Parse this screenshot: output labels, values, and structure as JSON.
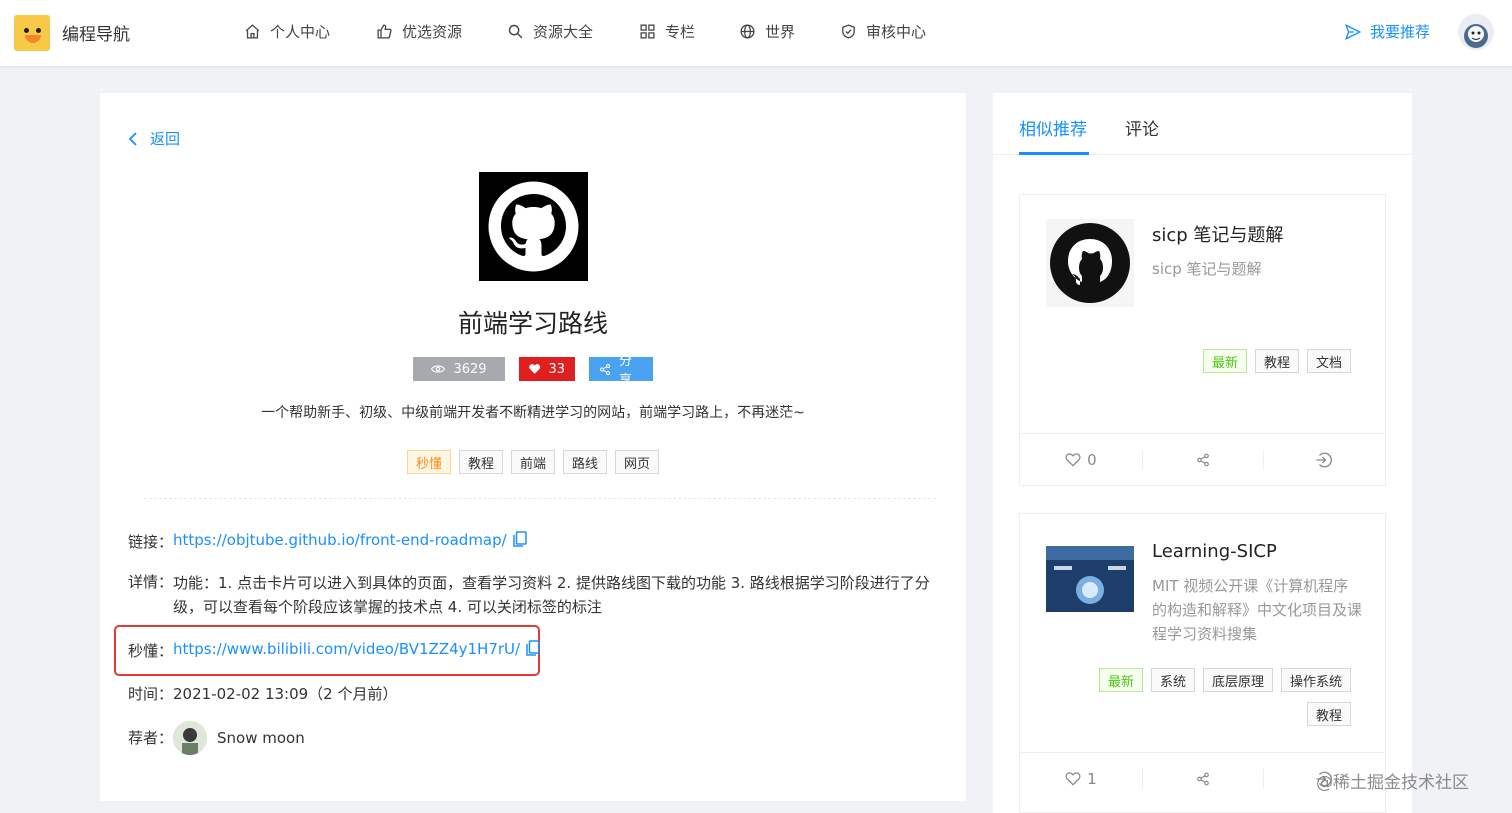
{
  "header": {
    "brand": "编程导航",
    "nav": [
      {
        "label": "个人中心",
        "icon": "home-icon"
      },
      {
        "label": "优选资源",
        "icon": "thumbs-up-icon"
      },
      {
        "label": "资源大全",
        "icon": "search-icon"
      },
      {
        "label": "专栏",
        "icon": "grid-icon"
      },
      {
        "label": "世界",
        "icon": "globe-icon"
      },
      {
        "label": "审核中心",
        "icon": "shield-check-icon"
      }
    ],
    "recommend_label": "我要推荐"
  },
  "main": {
    "back_label": "返回",
    "title": "前端学习路线",
    "views": "3629",
    "likes": "33",
    "share_label": "分享",
    "description": "一个帮助新手、初级、中级前端开发者不断精进学习的网站，前端学习路上，不再迷茫~",
    "tags": [
      "秒懂",
      "教程",
      "前端",
      "路线",
      "网页"
    ],
    "link_label": "链接：",
    "link_url": "https://objtube.github.io/front-end-roadmap/",
    "detail_label": "详情：",
    "detail_text": "功能：1. 点击卡片可以进入到具体的页面，查看学习资料 2. 提供路线图下载的功能 3. 路线根据学习阶段进行了分级，可以查看每个阶段应该掌握的技术点 4. 可以关闭标签的标注",
    "quick_label": "秒懂：",
    "quick_url": "https://www.bilibili.com/video/BV1ZZ4y1H7rU/",
    "time_label": "时间：",
    "time_value": "2021-02-02 13:09（2 个月前）",
    "recommender_label": "荐者：",
    "recommender_name": "Snow moon"
  },
  "side": {
    "tabs": [
      "相似推荐",
      "评论"
    ],
    "items": [
      {
        "title": "sicp 笔记与题解",
        "desc": "sicp 笔记与题解",
        "tags": [
          "最新",
          "教程",
          "文档"
        ],
        "likes": "0"
      },
      {
        "title": "Learning-SICP",
        "desc": "MIT 视频公开课《计算机程序的构造和解释》中文化项目及课程学习资料搜集",
        "tags": [
          "最新",
          "系统",
          "底层原理",
          "操作系统",
          "教程"
        ],
        "likes": "1"
      }
    ]
  },
  "watermark": "@稀土掘金技术社区",
  "colors": {
    "accent": "#1890ff",
    "highlight": "#e53935",
    "likes": "#e02020"
  }
}
